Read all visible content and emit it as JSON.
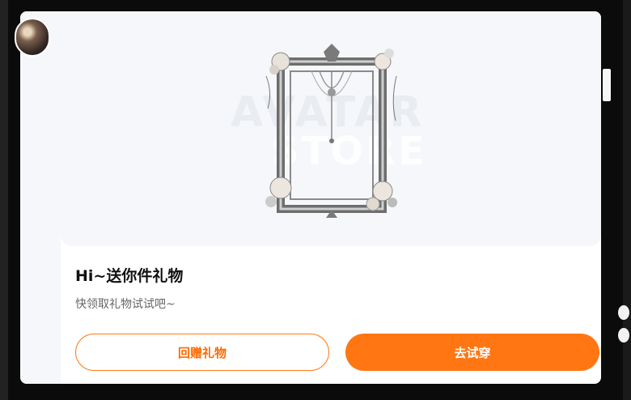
{
  "gift_card": {
    "watermark_line1": "AVATAR",
    "watermark_line2": "STORE",
    "title": "Hi~送你件礼物",
    "subtitle": "快领取礼物试试吧~",
    "return_gift_label": "回赠礼物",
    "try_on_label": "去试穿"
  },
  "colors": {
    "accent": "#ff7612",
    "preview_bg": "#f5f7fa",
    "title_text": "#111111",
    "subtitle_text": "#666666"
  },
  "icons": {
    "avatar": "user-avatar",
    "frame": "ornate-rose-frame"
  }
}
